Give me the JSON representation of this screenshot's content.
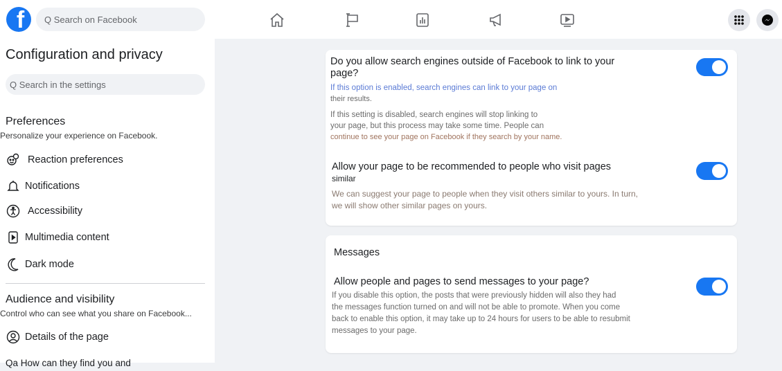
{
  "topbar": {
    "logo": "f",
    "search_placeholder": "Q Search on Facebook",
    "nav_icons": [
      "home-icon",
      "flag-icon",
      "insights-icon",
      "megaphone-icon",
      "video-icon"
    ],
    "right_icons": [
      "menu-grid-icon",
      "messenger-icon"
    ]
  },
  "sidebar": {
    "title": "Configuration and privacy",
    "search_placeholder": "Q Search in the settings",
    "preferences": {
      "title": "Preferences",
      "subtitle": "Personalize your experience on Facebook.",
      "items": [
        {
          "label": "Reaction preferences",
          "icon": "reaction-icon"
        },
        {
          "label": "Notifications",
          "icon": "bell-icon"
        },
        {
          "label": "Accessibility",
          "icon": "accessibility-icon"
        },
        {
          "label": "Multimedia content",
          "icon": "multimedia-icon"
        },
        {
          "label": "Dark mode",
          "icon": "moon-icon"
        }
      ]
    },
    "audience": {
      "title": "Audience and visibility",
      "subtitle": "Control who can see what you share on Facebook...",
      "items": [
        {
          "label": "Details of the page",
          "icon": "details-icon"
        },
        {
          "label": "Qa How can they find you and",
          "icon": ""
        }
      ]
    }
  },
  "main": {
    "card1": {
      "settings": [
        {
          "title_line1": "Do you allow search engines outside of Facebook to link to your",
          "title_line2": "page?",
          "desc1_line1": "If this option is enabled, search engines can link to your page on",
          "desc1_line2": "their results.",
          "desc2_line1": "If this setting is disabled, search engines will stop linking to",
          "desc2_line2": "your page, but this process may take some time. People can",
          "desc2_line3": "continue to see your page on Facebook if they search by your name.",
          "enabled": true
        },
        {
          "title_line1": "Allow your page to be recommended to people who visit pages",
          "title_line2": "similar",
          "desc_line1": "We can suggest your page to people when they visit others similar to yours. In turn,",
          "desc_line2": "we will show other similar pages on yours.",
          "enabled": true
        }
      ]
    },
    "card2": {
      "heading": "Messages",
      "title": "Allow people and pages to send messages to your page?",
      "desc_line1": "If you disable this option, the posts that were previously hidden will also they had",
      "desc_line2": "the messages function turned on and will not be able to promote. When you come",
      "desc_line3": "back to enable this option, it may take up to 24 hours for users to be able to resubmit",
      "desc_line4": "messages to your page.",
      "enabled": true
    }
  },
  "colors": {
    "accent": "#1877f2",
    "background": "#f0f2f5"
  }
}
